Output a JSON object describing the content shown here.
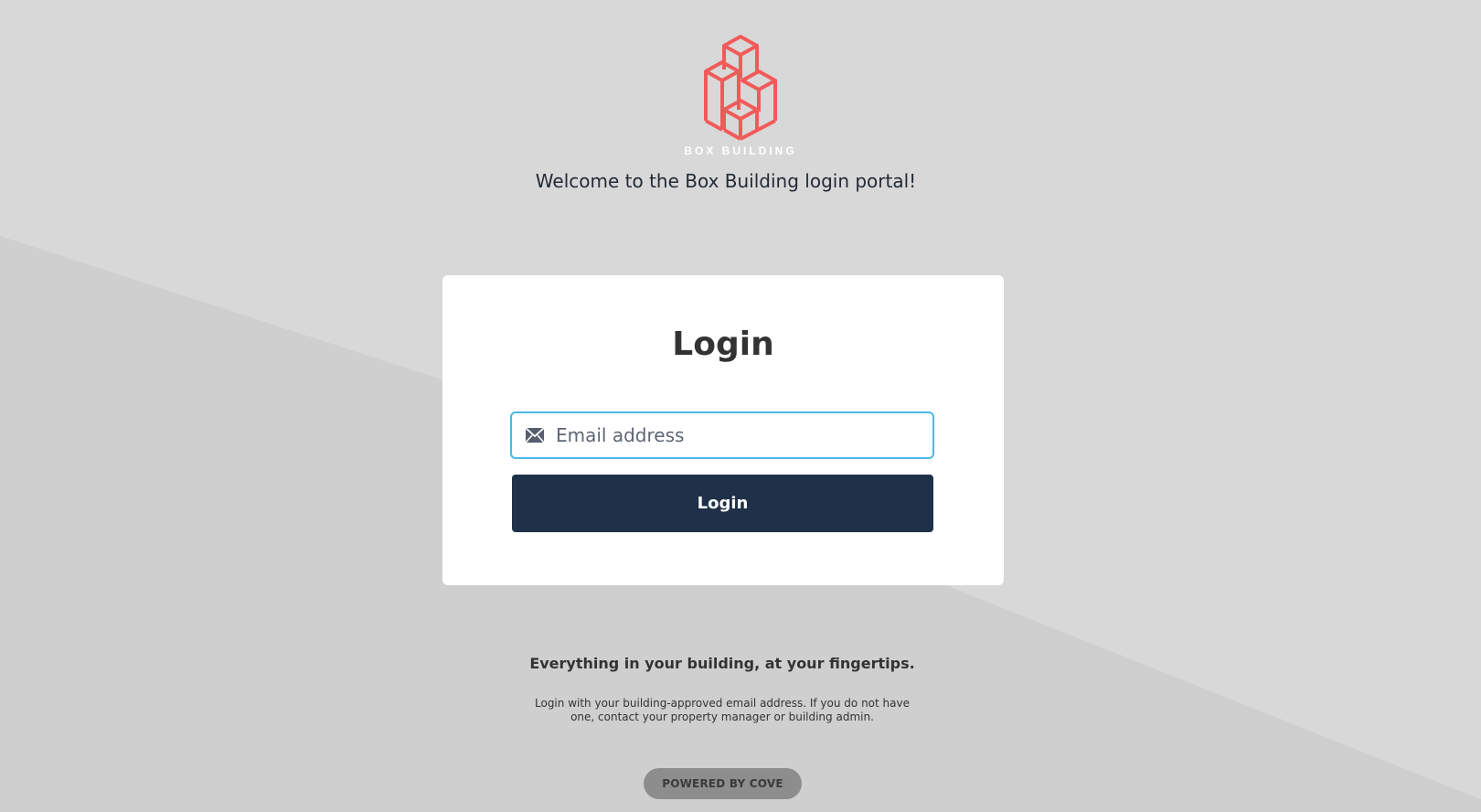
{
  "colors": {
    "background": "#d8d8d8",
    "background_shade": "#cfcfcf",
    "logo_accent": "#f25a5a",
    "primary_button": "#1e3148",
    "focus_border": "#4ab9e6",
    "badge": "#8d8d8d"
  },
  "brand": {
    "logo_icon": "box-building-logo-icon",
    "name": "BOX BUILDING"
  },
  "header": {
    "welcome": "Welcome to the Box Building login portal!"
  },
  "login_card": {
    "title": "Login",
    "email": {
      "icon": "mail-icon",
      "placeholder": "Email address",
      "value": ""
    },
    "button_label": "Login"
  },
  "footer": {
    "tagline": "Everything in your building, at your fingertips.",
    "help_text": "Login with your building-approved email address. If you do not have one, contact your property manager or building admin.",
    "powered_by": "POWERED BY COVE"
  }
}
